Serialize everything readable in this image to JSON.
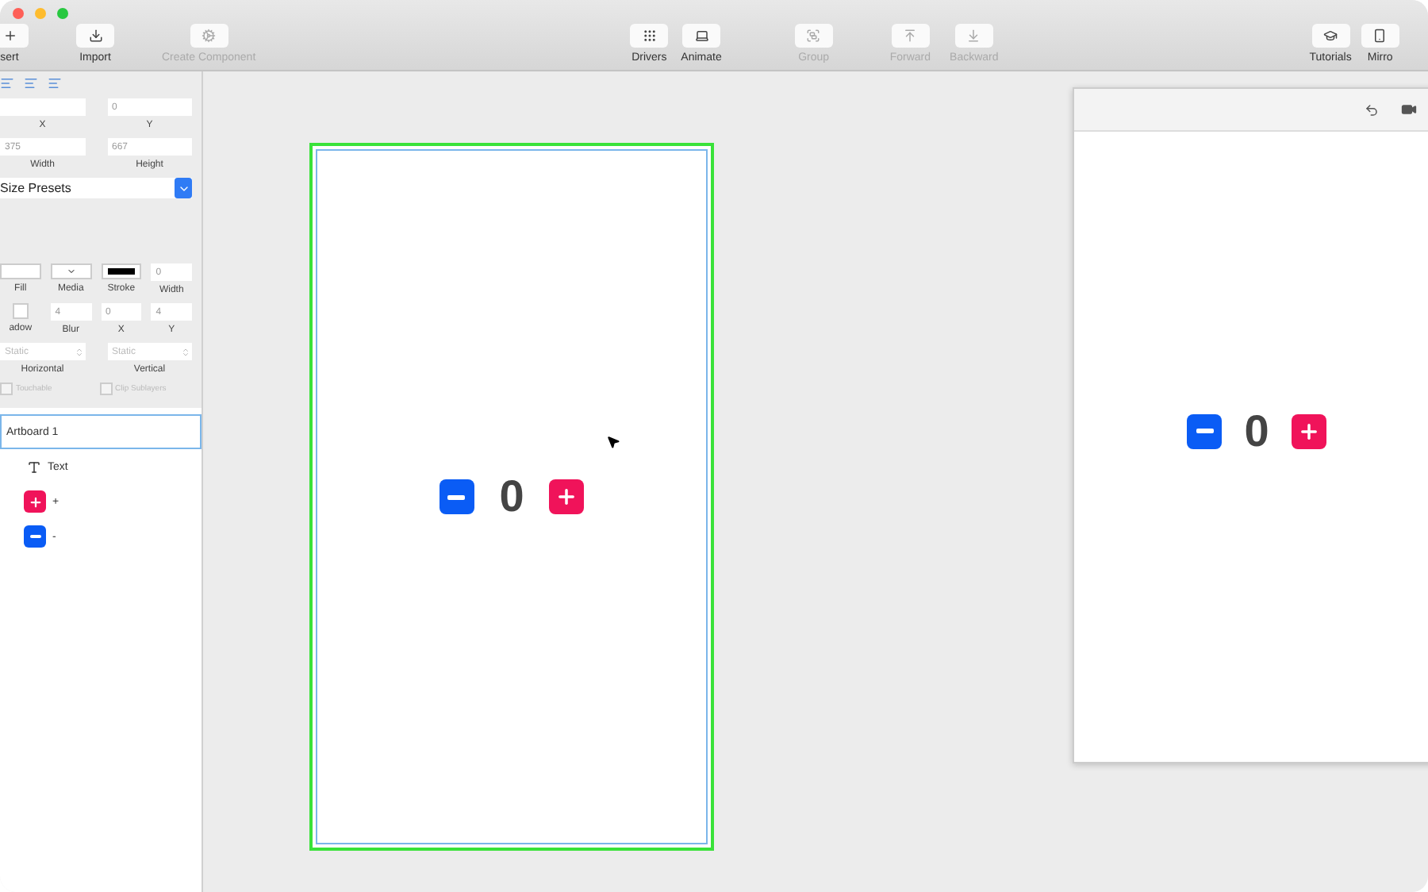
{
  "toolbar": {
    "groups": [
      [
        {
          "label": "sert",
          "disabled": false
        },
        {
          "label": "Import",
          "disabled": false
        },
        {
          "label": "Create Component",
          "disabled": true
        }
      ],
      [
        {
          "label": "Drivers",
          "disabled": false
        },
        {
          "label": "Animate",
          "disabled": false
        }
      ],
      [
        {
          "label": "Group",
          "disabled": true
        }
      ],
      [
        {
          "label": "Forward",
          "disabled": true
        },
        {
          "label": "Backward",
          "disabled": true
        }
      ],
      [
        {
          "label": "Tutorials",
          "disabled": false
        },
        {
          "label": "Mirro",
          "disabled": false
        }
      ]
    ]
  },
  "inspector": {
    "position": [
      {
        "label": "X"
      },
      {
        "label": "Y",
        "value": "0"
      }
    ],
    "size": [
      {
        "label": "Width",
        "value": "375"
      },
      {
        "label": "Height",
        "value": "667"
      }
    ],
    "size_presets": "Size Presets",
    "appearance": [
      {
        "label": "Fill",
        "kind": "swatch"
      },
      {
        "label": "Media",
        "kind": "media"
      },
      {
        "label": "Stroke",
        "kind": "stroke"
      },
      {
        "label": "Width",
        "kind": "field",
        "value": "0"
      }
    ],
    "shadow": [
      {
        "label": "adow",
        "kind": "shadow"
      },
      {
        "label": "Blur",
        "kind": "field",
        "value": "4"
      },
      {
        "label": "X",
        "kind": "field",
        "value": "0"
      },
      {
        "label": "Y",
        "kind": "field",
        "value": "4"
      }
    ],
    "pinning": [
      {
        "label": "Horizontal",
        "value": "Static"
      },
      {
        "label": "Vertical",
        "value": "Static"
      }
    ],
    "options": [
      {
        "label": "Touchable",
        "checked": false
      },
      {
        "label": "Clip Sublayers",
        "checked": false
      }
    ]
  },
  "layers": [
    {
      "name": "Artboard 1",
      "kind": "artboard",
      "selected": true
    },
    {
      "name": "Text",
      "kind": "text",
      "selected": false
    },
    {
      "name": "+",
      "kind": "plus",
      "selected": false
    },
    {
      "name": "-",
      "kind": "minus",
      "selected": false
    }
  ],
  "artboard": {
    "selected": true,
    "counter": "0"
  },
  "preview": {
    "counter": "0"
  }
}
